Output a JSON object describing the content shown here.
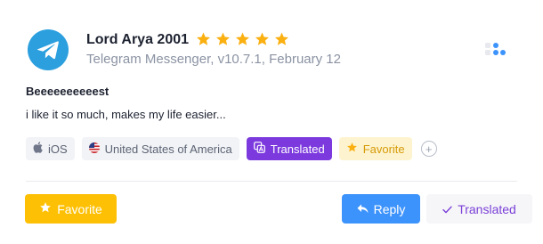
{
  "review": {
    "reviewer_name": "Lord Arya 2001",
    "rating": 5,
    "rating_max": 5,
    "app_name": "Telegram Messenger",
    "version": "v10.7.1",
    "date": "February 12",
    "meta_line": "Telegram Messenger, v10.7.1, February 12",
    "title": "Beeeeeeeeeest",
    "body": "i like it so much, makes my life easier..."
  },
  "tags": {
    "platform": "iOS",
    "country": "United States of America",
    "translated": "Translated",
    "favorite": "Favorite",
    "add": "+"
  },
  "actions": {
    "favorite_label": "Favorite",
    "reply_label": "Reply",
    "translated_label": "Translated"
  },
  "icons": {
    "app": "telegram-icon",
    "star": "star-icon",
    "grid": "grid-icon",
    "platform": "apple-icon",
    "country": "us-flag-icon",
    "translated": "translate-icon",
    "reply": "reply-icon",
    "check": "check-icon"
  },
  "colors": {
    "star": "#fbb011",
    "telegram": "#2c9fde",
    "translated_bg": "#7c3ade",
    "favorite_tag_bg": "#fdf4cf",
    "favorite_tag_text": "#d69a07",
    "favorite_button": "#fec004",
    "reply_button": "#3d93fc",
    "translated_button_text": "#7a3fd6"
  }
}
